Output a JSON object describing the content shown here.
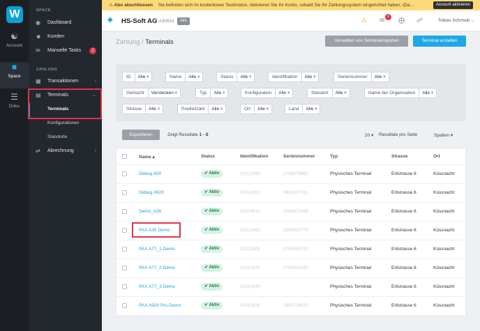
{
  "rail": {
    "items": [
      {
        "label": "Account",
        "icon": "users-icon"
      },
      {
        "label": "Space",
        "icon": "cube-icon"
      },
      {
        "label": "Doku",
        "icon": "book-icon"
      }
    ]
  },
  "sidebar": {
    "section_space": "SPACE",
    "section_zahlung": "ZAHLUNG",
    "items": [
      {
        "label": "Dashboard"
      },
      {
        "label": "Kunden"
      },
      {
        "label": "Manuelle Tasks",
        "badge": "2"
      },
      {
        "label": "Transaktionen"
      },
      {
        "label": "Terminals"
      }
    ],
    "sub_items": [
      "Terminals",
      "Konfigurationen",
      "Standorte"
    ],
    "abrechnung": "Abrechnung"
  },
  "banner": {
    "strong": "Abo abschliessen",
    "text": "Sie befinden sich im kostenlosen Testmodus. Aktivieren Sie Ihr Konto, sobald Sie Ihr Zahlungssystem eingerichtet haben. (Da...",
    "button": "Account aktivieren"
  },
  "header": {
    "title": "HS-Soft AG",
    "id": "#30831",
    "info": "Info",
    "notif_count": "2",
    "user": "Tobias Schmuki ⌵"
  },
  "breadcrumb": {
    "parent": "Zahlung",
    "sep": " / ",
    "current": "Terminals"
  },
  "actions": {
    "import": "Verwalten von Terminalimporten",
    "create": "Terminal erstellen"
  },
  "filters": [
    {
      "label": "ID",
      "value": "Alle"
    },
    {
      "label": "Name",
      "value": "Alle"
    },
    {
      "label": "Status",
      "value": "Alle"
    },
    {
      "label": "Identifikation",
      "value": "Alle"
    },
    {
      "label": "Seriennummer",
      "value": "Alle"
    },
    {
      "label": "Gelöscht",
      "value": "Verstecken"
    },
    {
      "label": "Typ",
      "value": "Alle"
    },
    {
      "label": "Konfiguration",
      "value": "Alle"
    },
    {
      "label": "Standort",
      "value": "Alle"
    },
    {
      "label": "Name der Organisation",
      "value": "Alle"
    },
    {
      "label": "Strasse",
      "value": "Alle"
    },
    {
      "label": "Postleitzahl",
      "value": "Alle"
    },
    {
      "label": "Ort",
      "value": "Alle"
    },
    {
      "label": "Land",
      "value": "Alle"
    }
  ],
  "toolbar": {
    "export": "Exportieren",
    "results_prefix": "Zeigt Resultate ",
    "results_range": "1 - 8",
    "per_page_value": "20",
    "per_page_label": "Resultate pro Seite",
    "columns": "Spalten"
  },
  "table": {
    "headers": [
      "Name ▴",
      "Status",
      "Identifikation",
      "Seriennummer",
      "Typ",
      "Strasse",
      "Ort"
    ],
    "rows": [
      {
        "name": "Debug A50",
        "status": "Aktiv",
        "ident": "32312563",
        "serial": "1706379861",
        "type": "Physisches Terminal",
        "street": "Erlistrasse 6",
        "city": "Küssnacht"
      },
      {
        "name": "Debug A920",
        "status": "Aktiv",
        "ident": "32312557",
        "serial": "0820347251",
        "type": "Physisches Terminal",
        "street": "Erlistrasse 6",
        "city": "Küssnacht"
      },
      {
        "name": "Demo_A35",
        "status": "Aktiv",
        "ident": "32314613",
        "serial": "2259823486",
        "type": "Physisches Terminal",
        "street": "Erlistrasse 6",
        "city": "Küssnacht"
      },
      {
        "name": "PAX A35 Demo",
        "status": "Aktiv",
        "ident": "32312662",
        "serial": "2259827770",
        "type": "Physisches Terminal",
        "street": "Erlistrasse 6",
        "city": "Küssnacht"
      },
      {
        "name": "PAX A77_1 Demo",
        "status": "Aktiv",
        "ident": "32312608",
        "serial": "1754351702",
        "type": "Physisches Terminal",
        "street": "Erlistrasse 6",
        "city": "Küssnacht"
      },
      {
        "name": "PAX A77_2 Demo",
        "status": "Aktiv",
        "ident": "32312624",
        "serial": "1754351622",
        "type": "Physisches Terminal",
        "street": "Erlistrasse 6",
        "city": "Küssnacht"
      },
      {
        "name": "PAX A77_3 Demo",
        "status": "Aktiv",
        "ident": "32312640",
        "serial": "",
        "type": "Physisches Terminal",
        "street": "Erlistrasse 6",
        "city": "Küssnacht"
      },
      {
        "name": "PAX A920 Pro Demo",
        "status": "Aktiv",
        "ident": "32312616",
        "serial": "1850734520",
        "type": "Physisches Terminal",
        "street": "Erlistrasse 6",
        "city": "Küssnacht"
      }
    ]
  }
}
